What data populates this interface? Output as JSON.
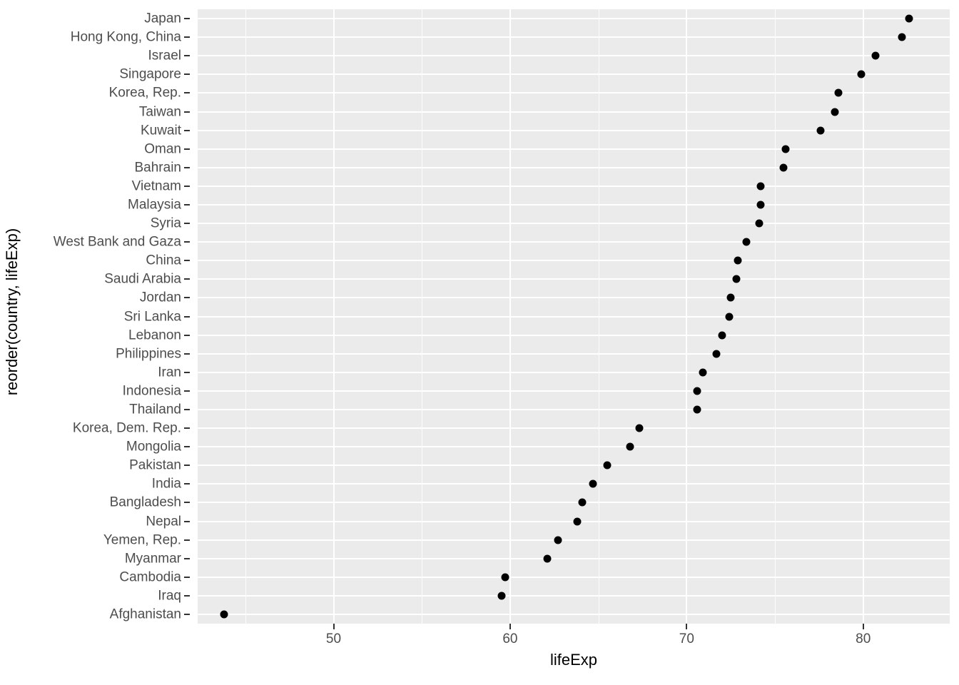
{
  "chart_data": {
    "type": "scatter",
    "title": "",
    "subtitle": "",
    "xlabel": "lifeExp",
    "ylabel": "reorder(country, lifeExp)",
    "x_tick_labels": [
      "50",
      "60",
      "70",
      "80"
    ],
    "x_tick_values": [
      50,
      60,
      70,
      80
    ],
    "x_minor_ticks": [
      45,
      55,
      65,
      75,
      85
    ],
    "xlim": [
      42.3,
      84.9
    ],
    "grid": true,
    "legend": "none",
    "panel_background": "#EBEBEB",
    "gridline_color": "#FFFFFF",
    "point_color": "#000000",
    "categories": [
      "Japan",
      "Hong Kong, China",
      "Israel",
      "Singapore",
      "Korea, Rep.",
      "Taiwan",
      "Kuwait",
      "Oman",
      "Bahrain",
      "Vietnam",
      "Malaysia",
      "Syria",
      "West Bank and Gaza",
      "China",
      "Saudi Arabia",
      "Jordan",
      "Sri Lanka",
      "Lebanon",
      "Philippines",
      "Iran",
      "Indonesia",
      "Thailand",
      "Korea, Dem. Rep.",
      "Mongolia",
      "Pakistan",
      "India",
      "Bangladesh",
      "Nepal",
      "Yemen, Rep.",
      "Myanmar",
      "Cambodia",
      "Iraq",
      "Afghanistan"
    ],
    "values": [
      82.6,
      82.2,
      80.7,
      79.9,
      78.6,
      78.4,
      77.6,
      75.6,
      75.5,
      74.2,
      74.2,
      74.1,
      73.4,
      72.9,
      72.8,
      72.5,
      72.4,
      72.0,
      71.7,
      70.9,
      70.6,
      70.6,
      67.3,
      66.8,
      65.5,
      64.7,
      64.1,
      63.8,
      62.7,
      62.1,
      59.7,
      59.5,
      43.8
    ]
  }
}
